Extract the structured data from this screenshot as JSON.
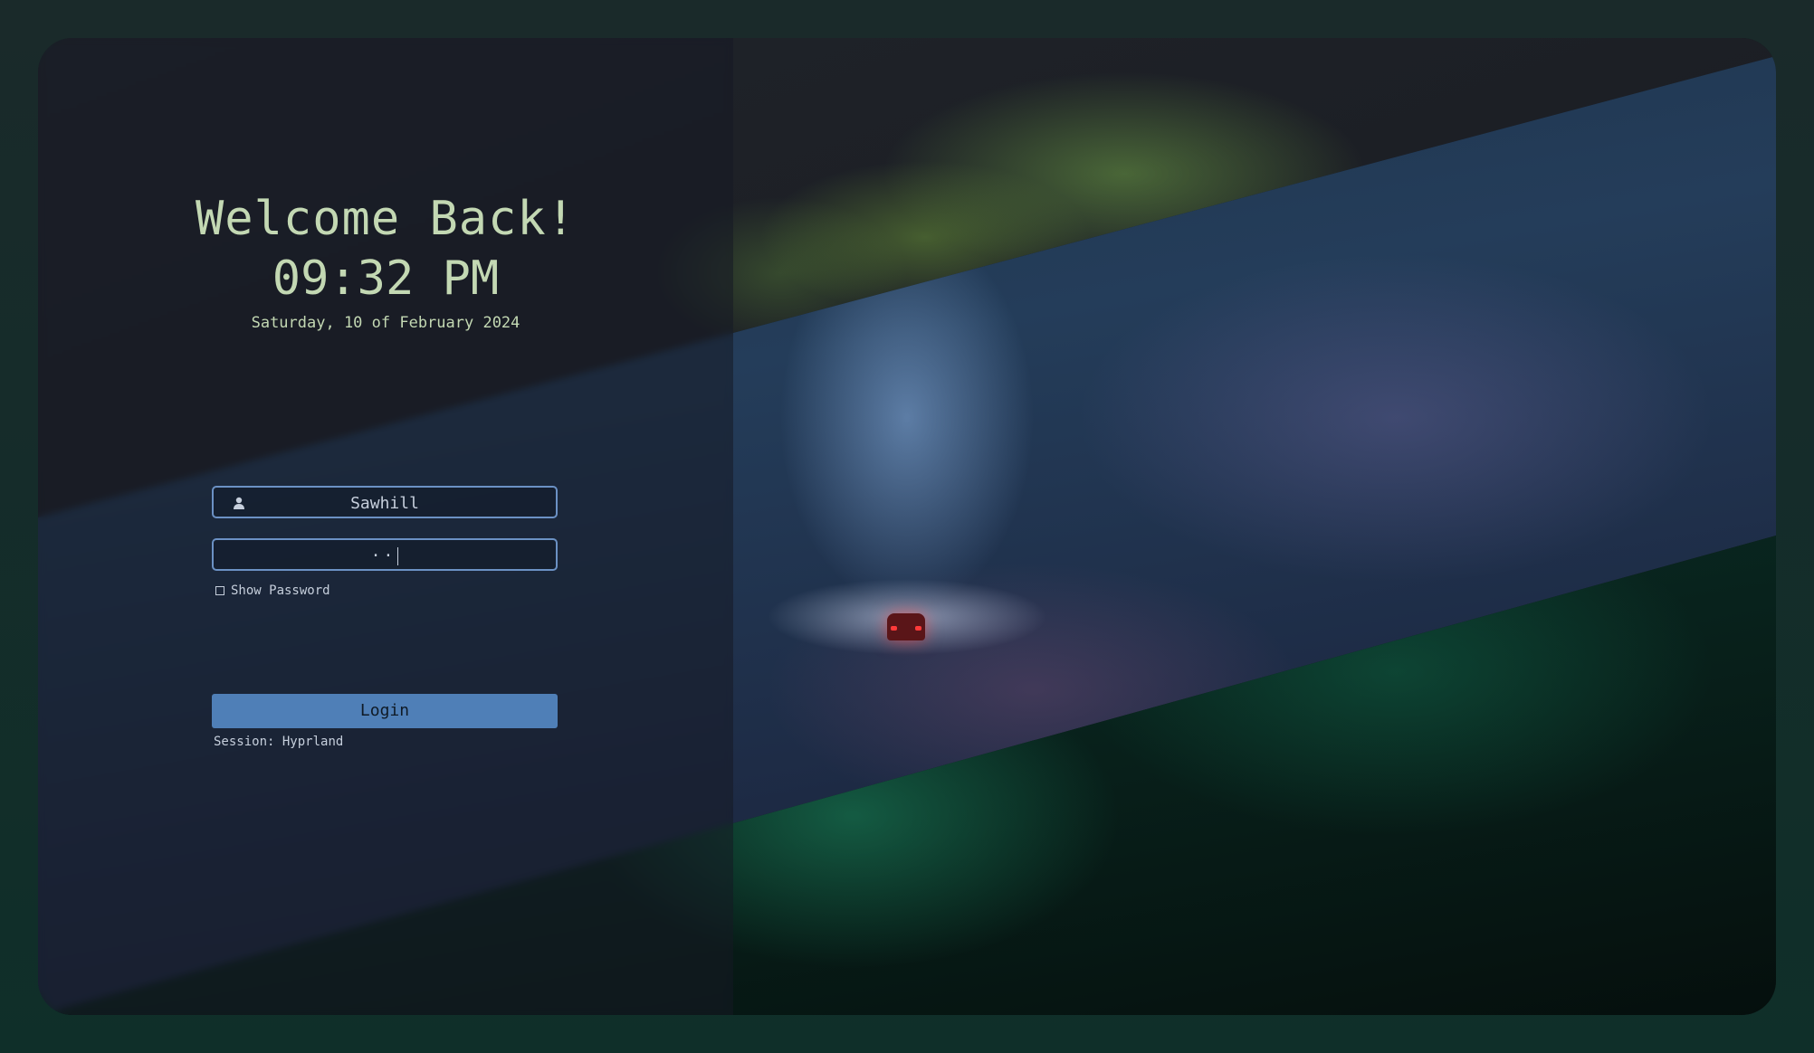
{
  "greeting": "Welcome Back!",
  "clock": "09:32 PM",
  "date": "Saturday, 10 of February 2024",
  "login_form": {
    "username": "Sawhill",
    "password_mask": "··",
    "show_password_label": "Show Password",
    "show_password_checked": false,
    "login_label": "Login",
    "session_label": "Session:",
    "session_value": "Hyprland"
  },
  "icons": {
    "user_field": "user-icon"
  },
  "colors": {
    "text_primary": "#c3d8b3",
    "field_border": "#6b91c4",
    "login_button": "#4f7fb7"
  }
}
